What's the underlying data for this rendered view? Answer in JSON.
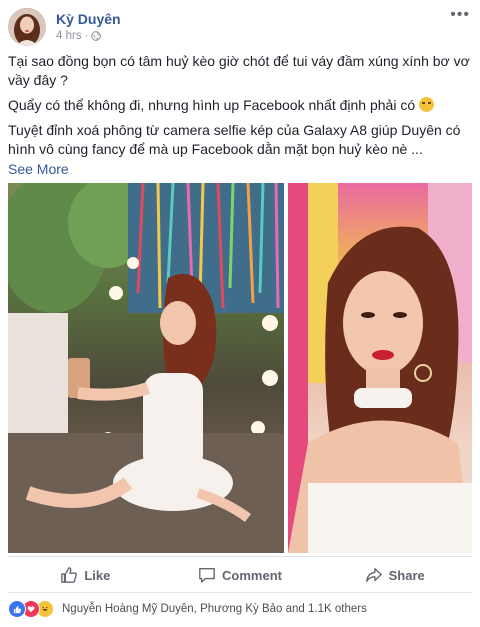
{
  "post": {
    "author": "Kỳ Duyên",
    "time": "4 hrs",
    "privacy_icon": "globe-icon",
    "text": {
      "para1": "Tại sao đồng bọn có tâm huỷ kèo giờ chót để tui váy đầm xúng xính bơ vơ vầy đây ?",
      "para2": "Quẩy có thể không đi, nhưng hình up Facebook nhất định phải có",
      "para3": "Tuyệt đỉnh xoá phông từ camera selfie kép của Galaxy A8 giúp Duyên có hình vô cùng fancy để mà up Facebook dằn mặt bọn huỷ kèo nè ...",
      "see_more": "See More"
    },
    "photos": [
      "photo-full-body-selfie",
      "photo-portrait-bokeh"
    ]
  },
  "actions": {
    "like": "Like",
    "comment": "Comment",
    "share": "Share"
  },
  "reactions": {
    "icons": [
      "like",
      "love",
      "haha"
    ],
    "summary": "Nguyễn Hoàng Mỹ Duyên, Phương Kỳ Bảo and 1.1K others"
  },
  "colors": {
    "link": "#365899",
    "meta": "#90949c",
    "action": "#606770",
    "like": "#3b74f0",
    "love": "#f0375a"
  }
}
